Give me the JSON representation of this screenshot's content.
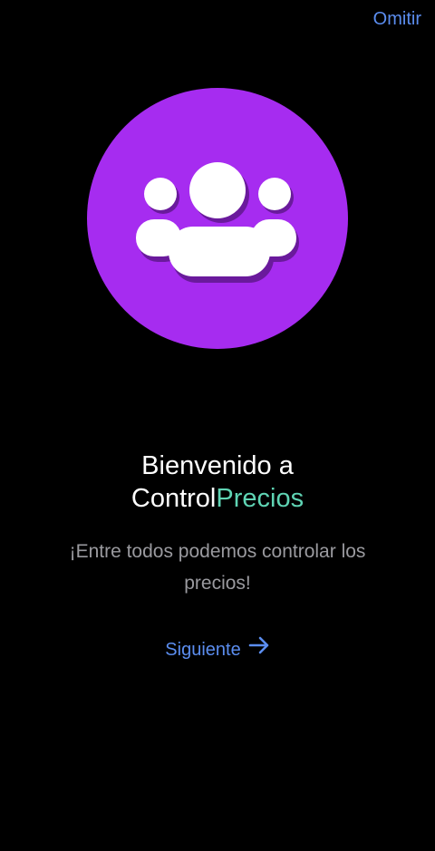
{
  "header": {
    "skip_label": "Omitir"
  },
  "hero": {
    "icon": "users-group-icon",
    "circle_color": "#a62cf0"
  },
  "welcome": {
    "title_line1": "Bienvenido a",
    "brand_part1": "Control",
    "brand_part2": "Precios",
    "brand_accent_color": "#5fd4b4",
    "subtitle": "¡Entre todos podemos controlar los precios!"
  },
  "actions": {
    "next_label": "Siguiente",
    "next_icon": "arrow-right-icon",
    "link_color": "#5b8def"
  }
}
